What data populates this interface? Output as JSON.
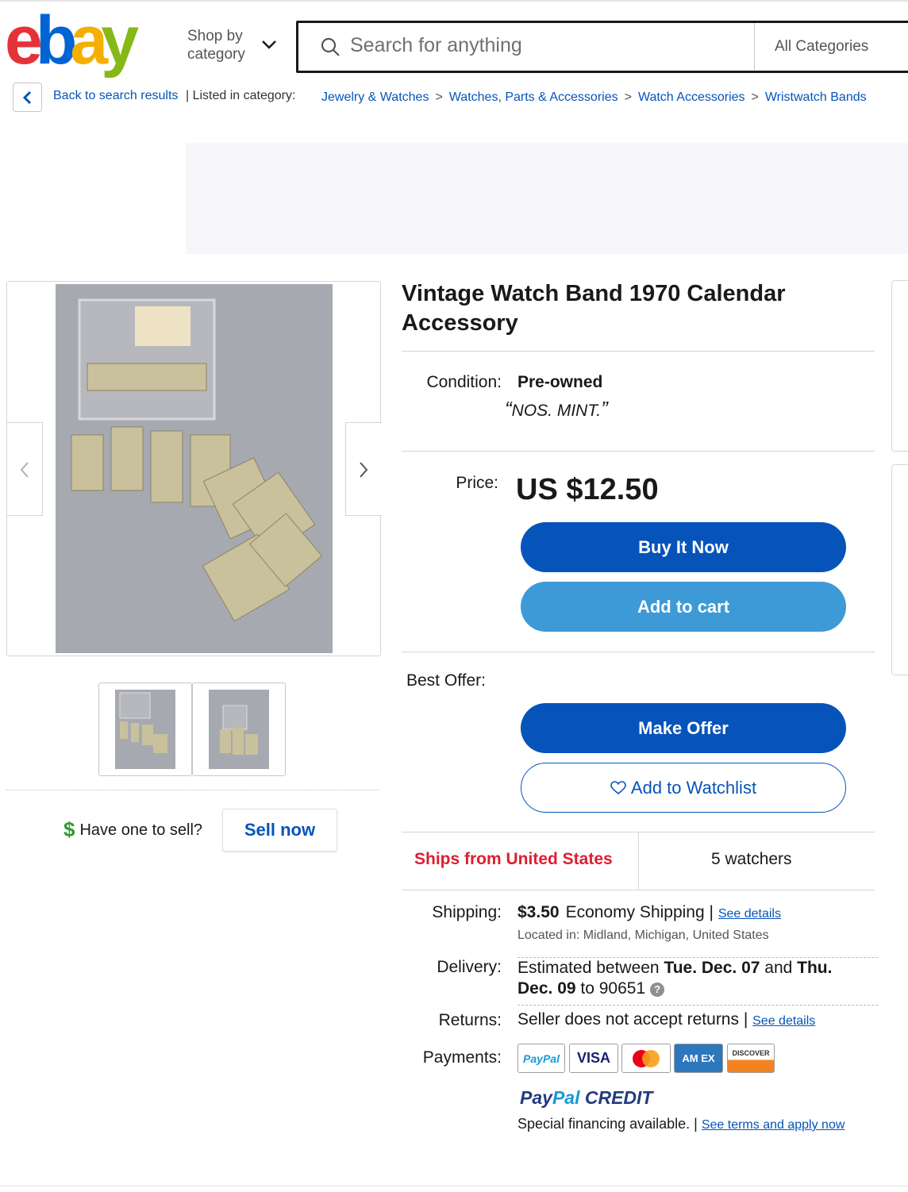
{
  "header": {
    "logo_text": "ebay",
    "shop_by": "Shop by",
    "shop_by_2": "category",
    "search_placeholder": "Search for anything",
    "categories": "All Categories"
  },
  "breadcrumb": {
    "back": "Back to search results",
    "listed": "| Listed in category:",
    "items": [
      "Jewelry & Watches",
      "Watches, Parts & Accessories",
      "Watch Accessories",
      "Wristwatch Bands"
    ]
  },
  "gallery": {
    "sell_question": "Have one to sell?",
    "sell_button": "Sell now"
  },
  "item": {
    "title": "Vintage Watch Band 1970 Calendar Accessory",
    "condition_label": "Condition:",
    "condition_value": "Pre-owned",
    "condition_note": "NOS. MINT.",
    "price_label": "Price:",
    "price": "US $12.50",
    "buy_now": "Buy It Now",
    "add_to_cart": "Add to cart",
    "best_offer_label": "Best Offer:",
    "make_offer": "Make Offer",
    "add_watchlist": "Add to Watchlist",
    "ships_from": "Ships from United States",
    "watchers": "5 watchers",
    "shipping_label": "Shipping:",
    "shipping_cost": "$3.50",
    "shipping_method": "Economy Shipping |",
    "see_details": "See details",
    "located": "Located in:  Midland, Michigan, United States",
    "delivery_label": "Delivery:",
    "delivery_pre": "Estimated between ",
    "delivery_from": "Tue. Dec. 07",
    "delivery_and": " and ",
    "delivery_to": "Thu. Dec. 09",
    "delivery_zip": " to 90651",
    "returns_label": "Returns:",
    "returns_value": "Seller does not accept returns |",
    "returns_link": "See details",
    "payments_label": "Payments:",
    "pay_methods": [
      "PayPal",
      "VISA",
      "",
      "AM EX",
      "DISCOVER"
    ],
    "ppcredit_1": "Pay",
    "ppcredit_2": "Pal",
    "ppcredit_3": " CREDIT",
    "financing": "Special financing available.  |",
    "financing_link": "See terms and apply now"
  },
  "colors": {
    "link": "#0654ba",
    "primary_button": "#0654ba",
    "secondary_button": "#3d9ad7",
    "ships_red": "#dd1e31"
  }
}
